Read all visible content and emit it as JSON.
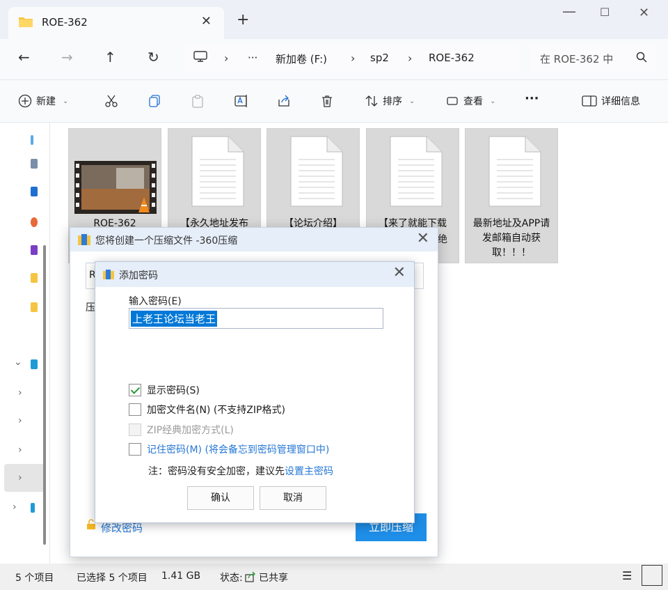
{
  "explorer": {
    "tab_title": "ROE-362",
    "new_tab_symbol": "+",
    "breadcrumb": [
      "新加卷 (F:)",
      "sp2",
      "ROE-362"
    ],
    "more_crumbs": "···",
    "search_placeholder": "在 ROE-362 中",
    "toolbar": {
      "new_label": "新建",
      "sort_label": "排序",
      "view_label": "查看",
      "more_label": "···",
      "details_label": "详细信息"
    },
    "files": [
      {
        "name": "ROE-362",
        "type": "video"
      },
      {
        "name": "【永久地址发布",
        "type": "doc"
      },
      {
        "name": "【论坛介绍】",
        "type": "doc"
      },
      {
        "name": "【来了就能下载",
        "type": "doc",
        "extra": "绝"
      },
      {
        "name": "最新地址及APP请发邮箱自动获取！！！",
        "type": "doc"
      }
    ],
    "status": {
      "item_count": "5 个项目",
      "selected": "已选择 5 个项目",
      "size": "1.41 GB",
      "state_label": "状态:",
      "state_value": "已共享"
    }
  },
  "compress_dialog": {
    "title": "您将创建一个压缩文件 -360压缩",
    "path_partial": "R",
    "label_partial": "压",
    "edit_password_link": "修改密码",
    "compress_now_button": "立即压缩"
  },
  "password_dialog": {
    "title": "添加密码",
    "input_label": "输入密码(E)",
    "password_value": "上老王论坛当老王",
    "options": {
      "show_password": {
        "label": "显示密码(S)",
        "checked": true
      },
      "encrypt_filename": {
        "label": "加密文件名(N) (不支持ZIP格式)",
        "checked": false
      },
      "zip_classic": {
        "label": "ZIP经典加密方式(L)",
        "checked": false,
        "disabled": true
      },
      "remember_password": {
        "label": "记住密码(M) (将会备忘到密码管理窗口中)",
        "checked": false
      }
    },
    "note_prefix": "注：密码没有安全加密，建议先",
    "note_link": "设置主密码",
    "ok_button": "确认",
    "cancel_button": "取消"
  }
}
